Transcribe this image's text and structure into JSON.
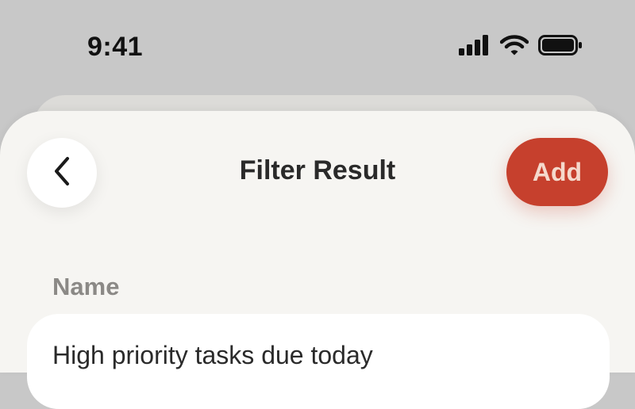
{
  "status_bar": {
    "time": "9:41",
    "icons": [
      "cellular-signal-icon",
      "wifi-icon",
      "battery-icon"
    ]
  },
  "header": {
    "back_icon": "chevron-left-icon",
    "title": "Filter Result",
    "add_label": "Add"
  },
  "form": {
    "name_label": "Name",
    "name_value": "High priority tasks due today"
  },
  "colors": {
    "accent": "#c6402d",
    "accent_text": "#f5d9cc",
    "background": "#c8c8c8",
    "sheet": "#f6f5f2",
    "label": "#8b8986"
  }
}
